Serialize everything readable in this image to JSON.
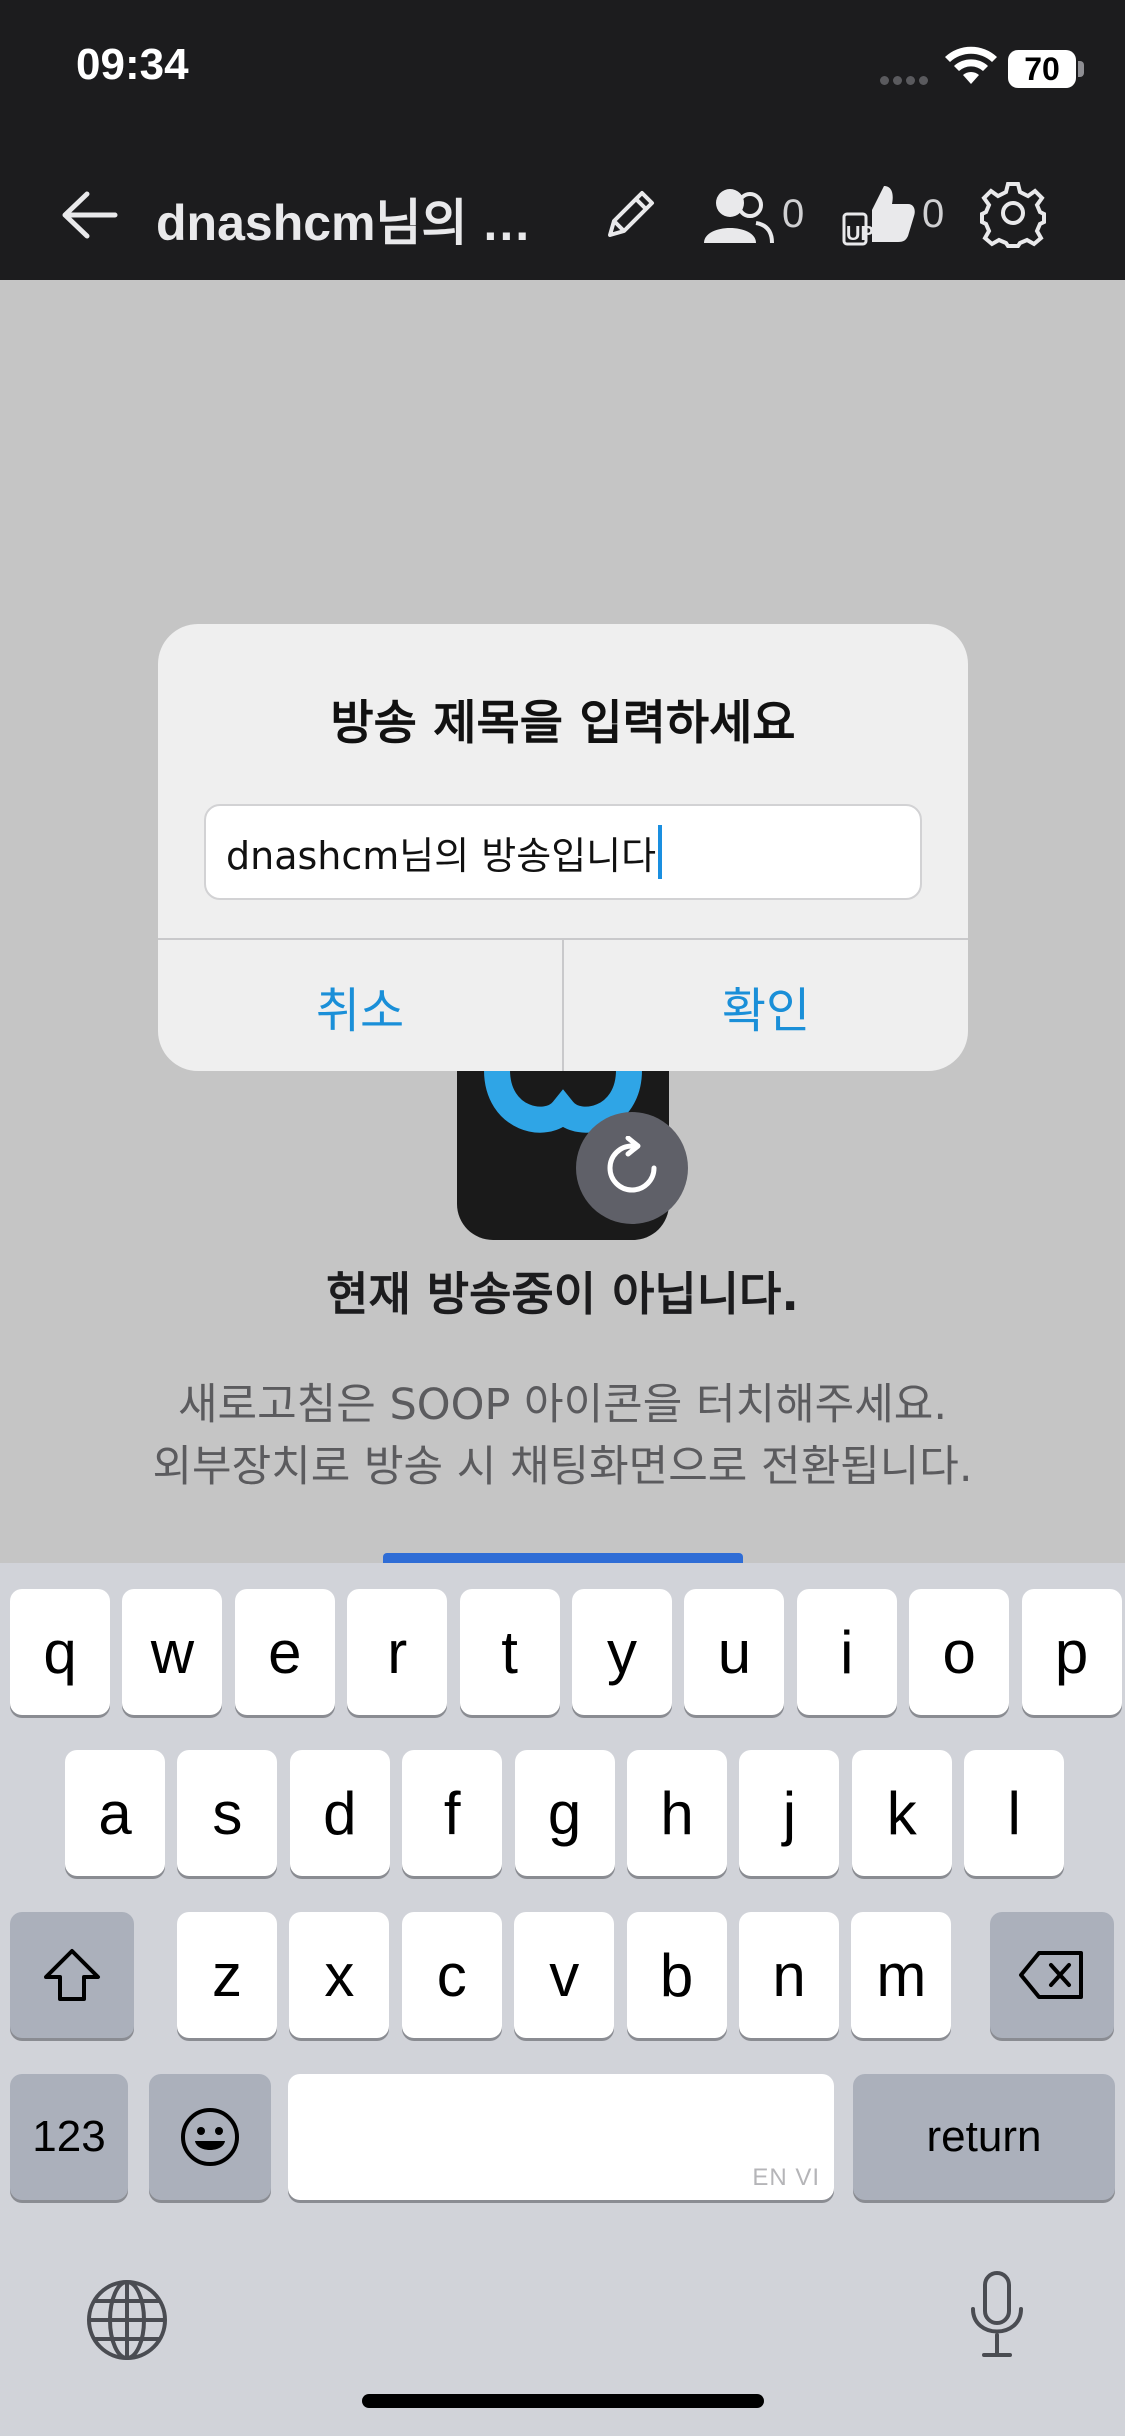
{
  "status_bar": {
    "time": "09:34",
    "battery": "70"
  },
  "nav": {
    "title": "dnashcm님의 방송입니다",
    "viewers": "0",
    "ups": "0"
  },
  "dialog": {
    "title": "방송 제목을 입력하세요",
    "input_value": "dnashcm님의 방송입니다",
    "cancel_label": "취소",
    "confirm_label": "확인"
  },
  "background": {
    "heading": "현재 방송중이 아닙니다.",
    "desc_line1": "새로고침은 SOOP 아이콘을 터치해주세요.",
    "desc_line2": "외부장치로 방송 시 채팅화면으로 전환됩니다."
  },
  "keyboard": {
    "row1": [
      "q",
      "w",
      "e",
      "r",
      "t",
      "y",
      "u",
      "i",
      "o",
      "p"
    ],
    "row2": [
      "a",
      "s",
      "d",
      "f",
      "g",
      "h",
      "j",
      "k",
      "l"
    ],
    "row3": [
      "z",
      "x",
      "c",
      "v",
      "b",
      "n",
      "m"
    ],
    "numbers_label": "123",
    "return_label": "return",
    "space_hint": "EN VI"
  },
  "colors": {
    "accent": "#1a8fd8",
    "nav_bg": "#1c1c1e",
    "keyboard_bg": "#d1d3d9"
  }
}
